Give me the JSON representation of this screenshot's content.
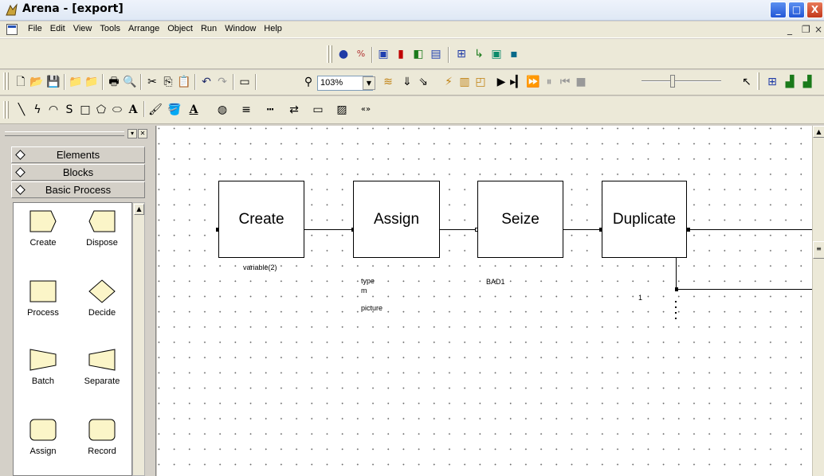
{
  "window": {
    "title": "Arena - [export]",
    "minimize": "_",
    "maximize": "□",
    "close": "X"
  },
  "menu": {
    "items": [
      "File",
      "Edit",
      "View",
      "Tools",
      "Arrange",
      "Object",
      "Run",
      "Window",
      "Help"
    ],
    "mdi_minimize": "_",
    "mdi_restore": "❐",
    "mdi_close": "×"
  },
  "toolbar": {
    "zoom": "103%"
  },
  "panel": {
    "tabs": [
      "Elements",
      "Blocks",
      "Basic Process"
    ],
    "modules": [
      "Create",
      "Dispose",
      "Process",
      "Decide",
      "Batch",
      "Separate",
      "Assign",
      "Record"
    ]
  },
  "canvas": {
    "blocks": [
      "Create",
      "Assign",
      "Seize",
      "Duplicate"
    ],
    "create_label": "variable(2)",
    "assign_labels": [
      "type",
      "m",
      "picture"
    ],
    "seize_label": "BAD1",
    "duplicate_label": "1"
  },
  "colors": {
    "module_fill": "#fbf5c8",
    "canvas_bg": "#ffffff",
    "chrome": "#ece9d8"
  }
}
